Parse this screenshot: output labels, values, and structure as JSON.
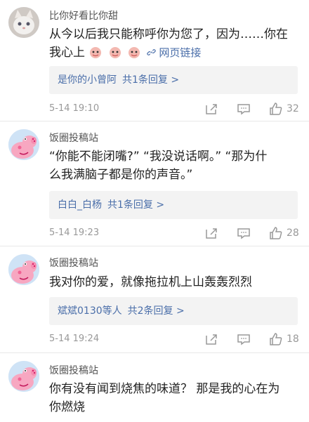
{
  "comments": [
    {
      "username": "比你好看比你甜",
      "text": "从今以后我只能称呼你为您了，因为……你在",
      "text_line2": "我心上",
      "link_label": "网页链接",
      "reply_author": "是你的小曾阿",
      "reply_count": "共1条回复 >",
      "time": "5-14 19:10",
      "likes": "32",
      "avatar": "cat-avatar"
    },
    {
      "username": "饭圈投稿站",
      "text": "“你能不能闭嘴?” “我没说话啊。” “那为什",
      "text_line2": "么我满脑子都是你的声音。”",
      "reply_author": "白白_白杨",
      "reply_count": "共1条回复 >",
      "time": "5-14 19:23",
      "likes": "28",
      "avatar": "peppa-pig-avatar"
    },
    {
      "username": "饭圈投稿站",
      "text": "我对你的爱，就像拖拉机上山轰轰烈烈",
      "reply_author": "斌斌0130等人",
      "reply_count": "共2条回复 >",
      "time": "5-14 19:24",
      "likes": "18",
      "avatar": "peppa-pig-avatar"
    },
    {
      "username": "饭圈投稿站",
      "text": "你有没有闻到烧焦的味道？ 那是我的心在为",
      "text_line2": "你燃烧",
      "avatar": "peppa-pig-avatar"
    }
  ],
  "icons": {
    "share": "share-icon",
    "comment": "comment-icon",
    "like": "thumbs-up-icon",
    "link": "link-icon"
  },
  "colors": {
    "link": "#4a6ea9",
    "reply_bg": "#f3f3f3",
    "meta": "#999999"
  }
}
